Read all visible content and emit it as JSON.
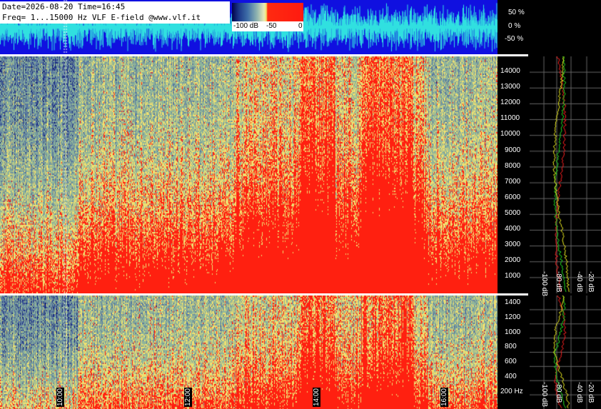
{
  "header": {
    "line1": "Date=2026-08-20 Time=16:45",
    "line2": "Freq= 1...15000 Hz   VLF E-field @www.vlf.it"
  },
  "colorbar": {
    "tick_labels": [
      "-100 dB",
      "-50",
      "0"
    ]
  },
  "waveform": {
    "percent_labels": [
      "50 %",
      "0 %",
      "-50 %"
    ],
    "colors": {
      "background": "#1010e0",
      "trace": "#30e0e0"
    }
  },
  "upper_spectrum": {
    "freq_labels": [
      "14000",
      "13000",
      "12000",
      "11000",
      "10000",
      "9000",
      "8000",
      "7000",
      "6000",
      "5000",
      "4000",
      "3000",
      "2000",
      "1000"
    ],
    "db_labels": [
      "-100 dB",
      "-80 dB",
      "-40 dB",
      "-20 dB"
    ]
  },
  "lower_spectrum": {
    "freq_labels": [
      "1400",
      "1200",
      "1000",
      "800",
      "600",
      "400",
      "200 Hz"
    ],
    "db_labels": [
      "-100 dB",
      "-80 dB",
      "-40 dB",
      "-20 dB"
    ]
  },
  "time_axis": {
    "labels": [
      "10:00",
      "12:00",
      "14:00",
      "16:00"
    ]
  },
  "colors": {
    "spectrum_red": "#ff2010",
    "spectrum_yellow": "#f0e070",
    "spectrum_green": "#8fb49a",
    "spectrum_blue": "#1a2a80",
    "curve_red": "#ff2020",
    "curve_green": "#20e020",
    "curve_yellow": "#f0f020"
  }
}
